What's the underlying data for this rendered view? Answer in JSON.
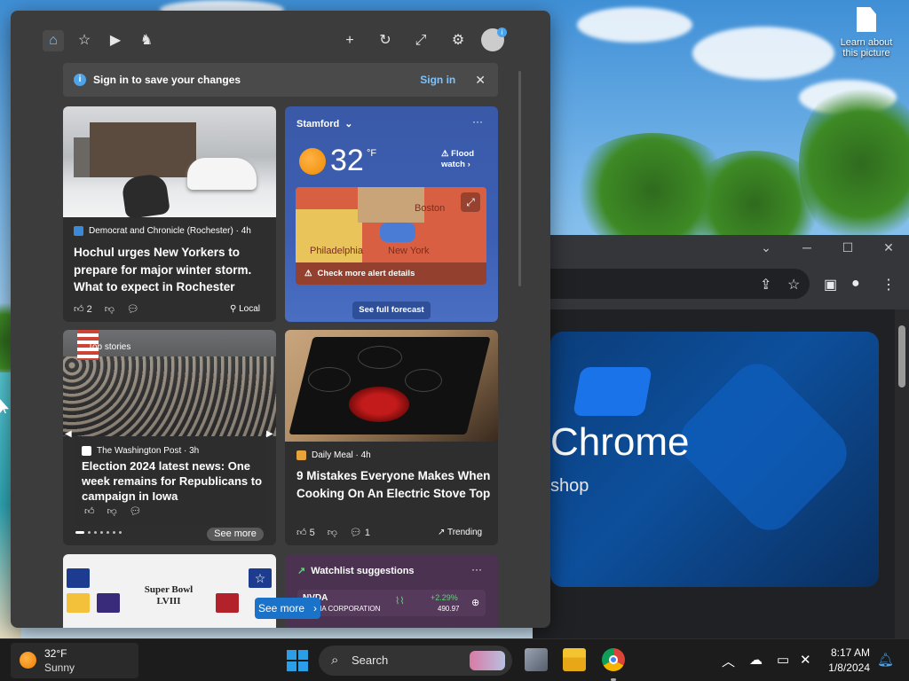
{
  "desktop": {
    "icon_label": "Learn about this picture"
  },
  "widgets": {
    "signin_banner": {
      "message": "Sign in to save your changes",
      "link": "Sign in"
    },
    "cards": {
      "news1": {
        "source": "Democrat and Chronicle (Rochester) · 4h",
        "headline": "Hochul urges New Yorkers to prepare for major winter storm. What to expect in Rochester",
        "likes": "2",
        "tag": "Local"
      },
      "weather": {
        "location": "Stamford",
        "temperature": "32",
        "unit": "°F",
        "alert": "Flood watch",
        "map_labels": [
          "Boston",
          "Philadelphia",
          "New York"
        ],
        "alert_details": "Check more alert details",
        "forecast_button": "See full forecast"
      },
      "top_stories": {
        "label": "Top stories",
        "source": "The Washington Post · 3h",
        "headline": "Election 2024 latest news: One week remains for Republicans to campaign in Iowa",
        "see_more": "See more"
      },
      "recipe": {
        "source": "Daily Meal · 4h",
        "headline": "9 Mistakes Everyone Makes When Cooking On An Electric Stove Top",
        "likes": "5",
        "comments": "1",
        "tag": "Trending"
      },
      "superbowl": {
        "title": "Super Bowl LVIII"
      },
      "watchlist": {
        "title": "Watchlist suggestions",
        "ticker": "NVDA",
        "company": "NVIDIA CORPORATION",
        "change": "+2.29%",
        "price": "490.97"
      }
    },
    "see_more_button": "See more"
  },
  "chrome": {
    "hero_title": "Chrome",
    "hero_sub": "shop"
  },
  "taskbar": {
    "weather_temp": "32°F",
    "weather_cond": "Sunny",
    "search_label": "Search",
    "time": "8:17 AM",
    "date": "1/8/2024"
  },
  "colors": {
    "accent": "#7cc3ff",
    "panel": "#3c3c3c",
    "card": "#2e2e2e",
    "see_more_blue": "#1a73c9",
    "windows_blue": "#2b9ee8"
  }
}
